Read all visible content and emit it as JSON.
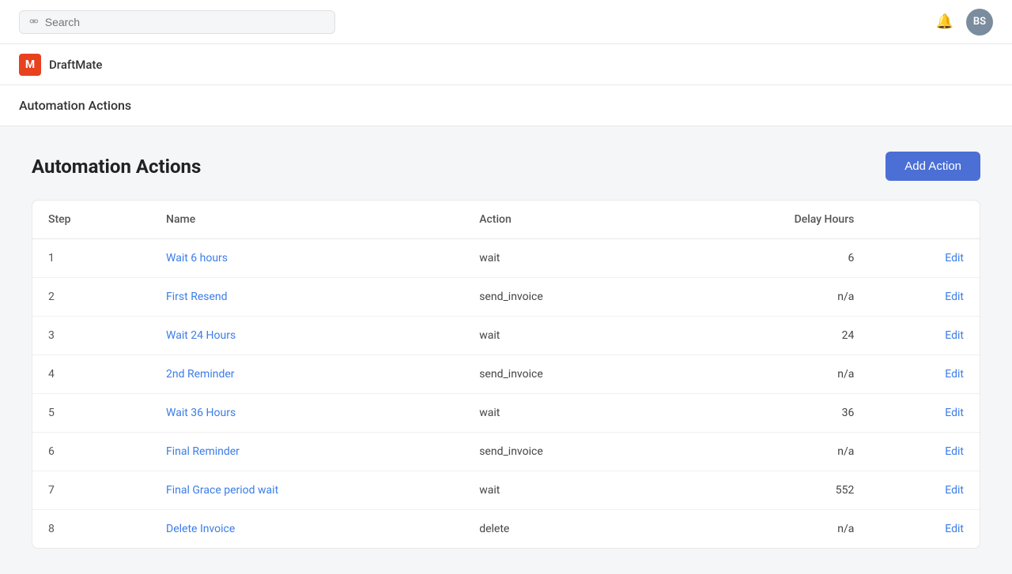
{
  "topbar": {
    "search_placeholder": "Search",
    "avatar_initials": "BS"
  },
  "brand": {
    "logo_text": "M",
    "name": "DraftMate"
  },
  "page": {
    "title": "Automation Actions",
    "content_title": "Automation Actions",
    "add_action_label": "Add Action"
  },
  "table": {
    "columns": [
      "Step",
      "Name",
      "Action",
      "Delay Hours"
    ],
    "rows": [
      {
        "step": "1",
        "name": "Wait 6 hours",
        "action": "wait",
        "delay": "6"
      },
      {
        "step": "2",
        "name": "First Resend",
        "action": "send_invoice",
        "delay": "n/a"
      },
      {
        "step": "3",
        "name": "Wait 24 Hours",
        "action": "wait",
        "delay": "24"
      },
      {
        "step": "4",
        "name": "2nd Reminder",
        "action": "send_invoice",
        "delay": "n/a"
      },
      {
        "step": "5",
        "name": "Wait 36 Hours",
        "action": "wait",
        "delay": "36"
      },
      {
        "step": "6",
        "name": "Final Reminder",
        "action": "send_invoice",
        "delay": "n/a"
      },
      {
        "step": "7",
        "name": "Final Grace period wait",
        "action": "wait",
        "delay": "552"
      },
      {
        "step": "8",
        "name": "Delete Invoice",
        "action": "delete",
        "delay": "n/a"
      }
    ],
    "edit_label": "Edit"
  }
}
